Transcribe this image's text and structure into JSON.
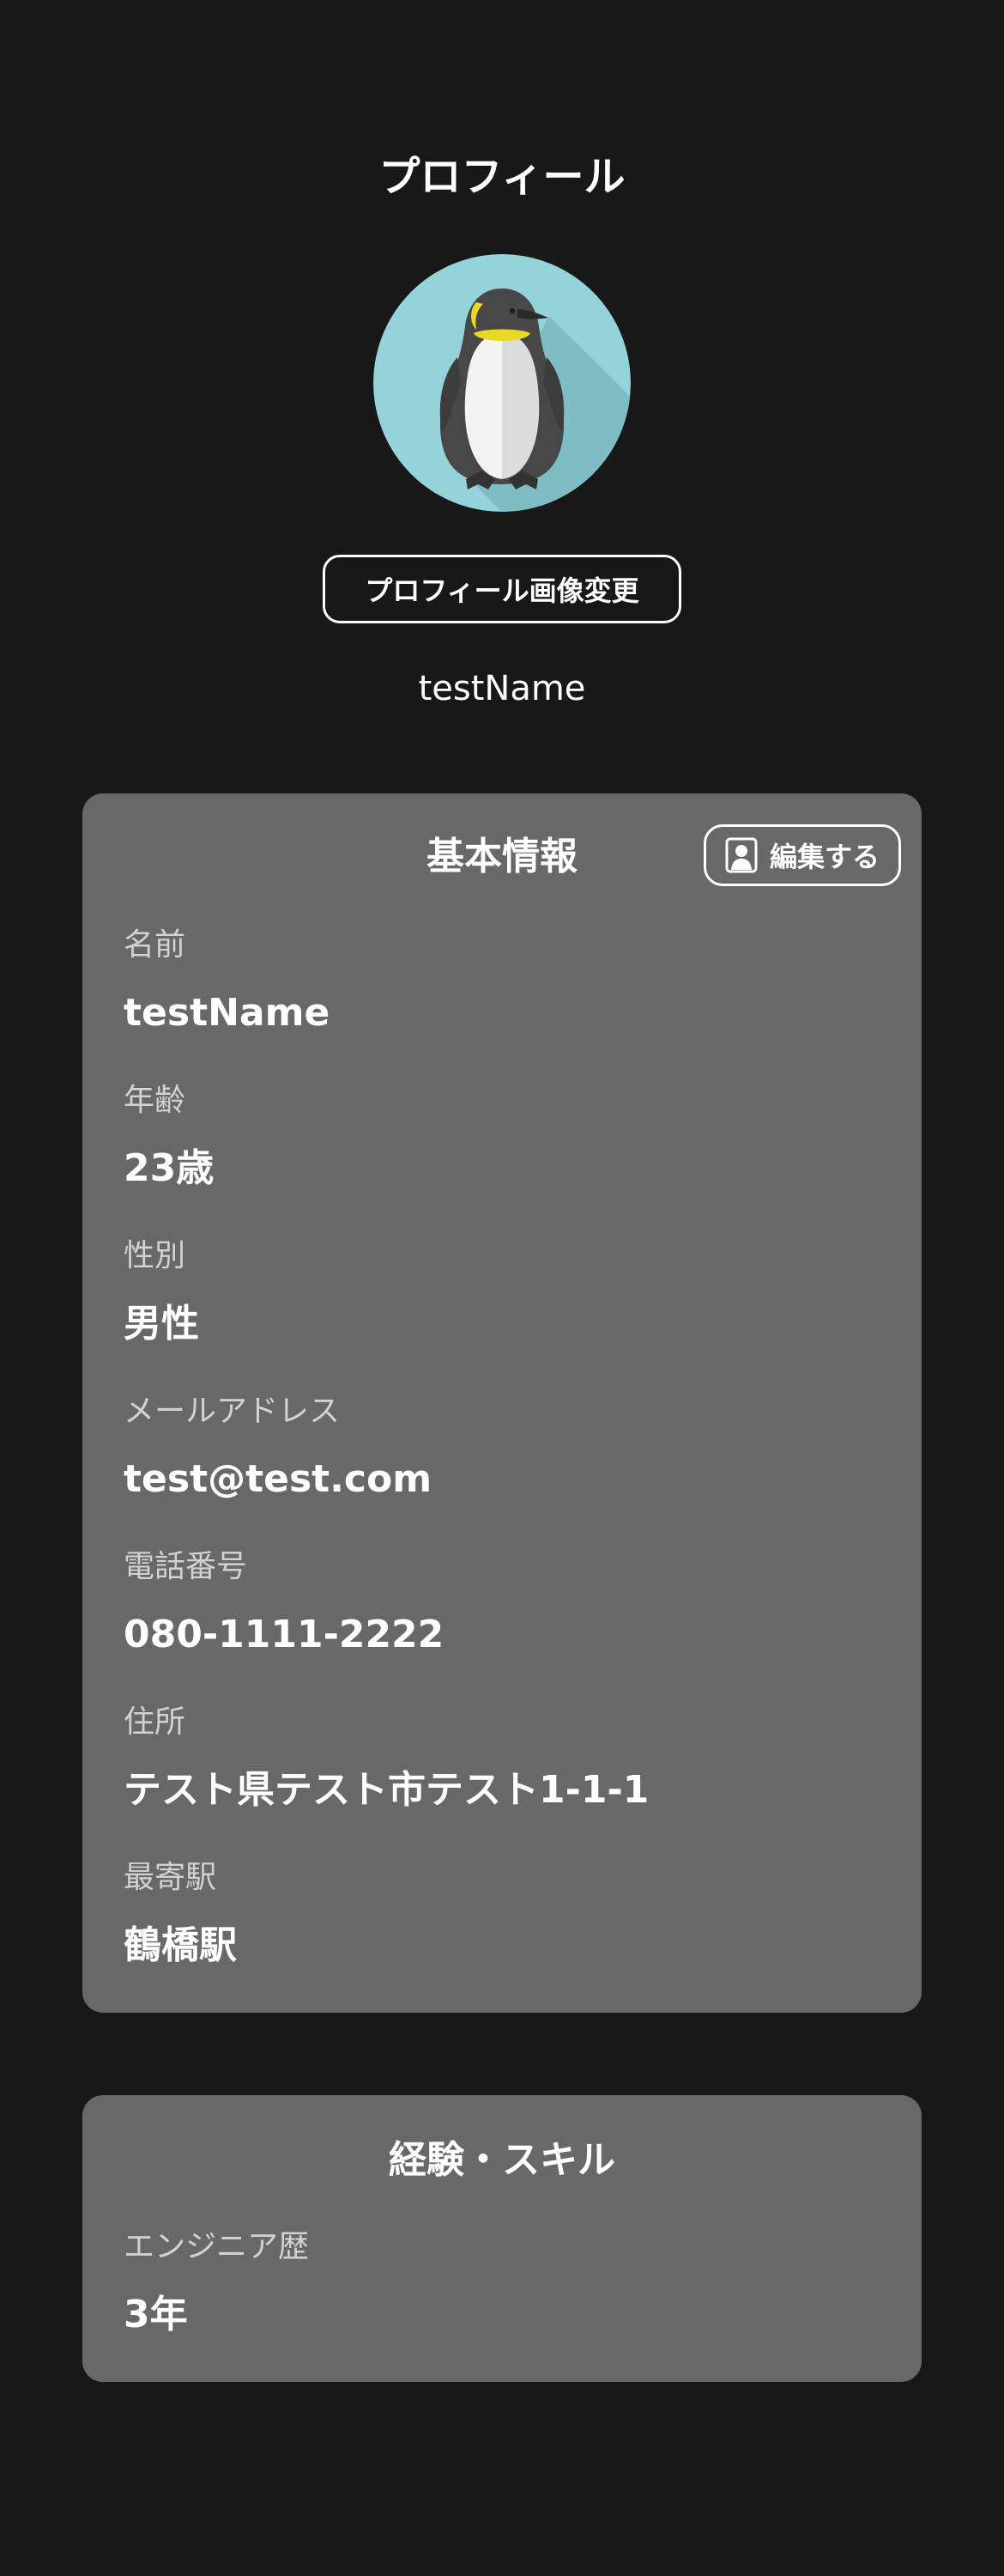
{
  "header": {
    "title": "プロフィール"
  },
  "profile": {
    "avatar_icon": "penguin-avatar",
    "change_photo_label": "プロフィール画像変更",
    "display_name": "testName"
  },
  "basic_info": {
    "title": "基本情報",
    "edit_label": "編集する",
    "edit_icon": "person-icon",
    "fields": [
      {
        "label": "名前",
        "value": "testName"
      },
      {
        "label": "年齢",
        "value": "23歳"
      },
      {
        "label": "性別",
        "value": "男性"
      },
      {
        "label": "メールアドレス",
        "value": "test@test.com"
      },
      {
        "label": "電話番号",
        "value": "080-1111-2222"
      },
      {
        "label": "住所",
        "value": "テスト県テスト市テスト1-1-1"
      },
      {
        "label": "最寄駅",
        "value": "鶴橋駅"
      }
    ]
  },
  "skills": {
    "title": "経験・スキル",
    "fields": [
      {
        "label": "エンジニア歴",
        "value": "3年"
      }
    ]
  },
  "colors": {
    "background": "#181818",
    "card": "#686868",
    "text": "#ffffff",
    "label": "#d2d2d2",
    "avatar_bg": "#95d3db"
  }
}
